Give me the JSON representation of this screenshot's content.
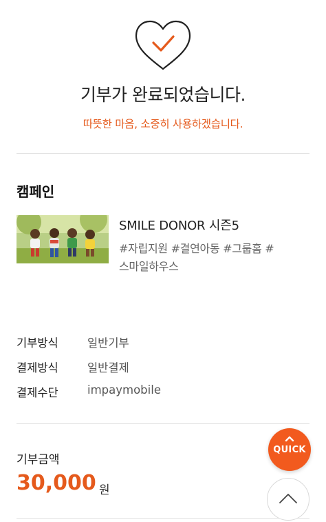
{
  "hero": {
    "icon": "heart-check-icon",
    "title": "기부가 완료되었습니다.",
    "subtitle": "따뜻한 마음, 소중히 사용하겠습니다."
  },
  "campaign": {
    "section_title": "캠페인",
    "image": "children-running-photo",
    "name": "SMILE DONOR 시즌5",
    "tags_line1": "#자립지원 #결연아동 #그룹홈 #",
    "tags_line2": "스마일하우스"
  },
  "details": [
    {
      "label": "기부방식",
      "value": "일반기부"
    },
    {
      "label": "결제방식",
      "value": "일반결제"
    },
    {
      "label": "결제수단",
      "value": "impaymobile"
    }
  ],
  "amount": {
    "label": "기부금액",
    "value": "30,000",
    "unit": "원"
  },
  "floating": {
    "quick_label": "QUICK",
    "quick_icon": "chevron-up-icon",
    "top_icon": "chevron-up-icon"
  },
  "colors": {
    "accent": "#e55a1c",
    "quick_bg": "#f25a1e"
  }
}
